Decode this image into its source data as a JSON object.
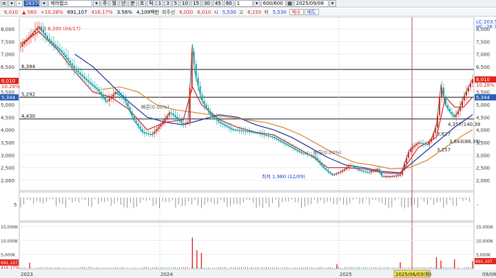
{
  "toolbar": {
    "stock_code": "263700",
    "stock_name": "케어랩스",
    "periods": [
      "주",
      "월",
      "년",
      "분",
      "초",
      "틱"
    ],
    "minute_intervals": [
      "1",
      "3",
      "5",
      "10",
      "15",
      "30",
      "45",
      "60"
    ],
    "count_display": "600/600",
    "date": "2025/09/08"
  },
  "quote": {
    "price": "6,010",
    "change": "560",
    "change_pct": "+10.28%",
    "volume": "691,107",
    "volume_ratio": "416.17%",
    "turnover": "3.56%",
    "amount": "4,109백만",
    "turnover_label": "회주선",
    "prev_close": "6,020",
    "open_label": "시",
    "open": "5,530",
    "high_label": "고",
    "high": "6,150",
    "low_label": "저",
    "low": "5,530",
    "buy_label": "매수",
    "sell_label": "매도",
    "fake_price": "6,010"
  },
  "right_labels": {
    "lc": "LC:203.5",
    "hc": "HC:-26.7",
    "price_tag": "6,010",
    "pct_tag": "10.28%",
    "tag_5344": "5,344",
    "volume_tag": "691,107",
    "volume_pct": "416.17%"
  },
  "colors": {
    "up": "#e0241a",
    "down": "#1a3fd8",
    "candle_down": "#17a5a8",
    "ma_red": "#d21f1f",
    "ma_navy": "#1c2c9c",
    "ma_orange": "#d9822b",
    "highlight_bg": "#fde84a",
    "selected_bg": "#2c5fb8"
  },
  "chart_data": {
    "type": "line",
    "title": "",
    "x_ticks": [
      "2023",
      "2024",
      "2025",
      "09/08"
    ],
    "selected_date": "2025/06/03(화)",
    "y_ticks": [
      "8,000",
      "7,500",
      "7,000",
      "6,500",
      "6,000",
      "5,500",
      "5,000",
      "4,500",
      "4,000",
      "3,500",
      "3,000",
      "2,500",
      "2,000"
    ],
    "ylim": [
      1700,
      8300
    ],
    "horizontal_levels": [
      {
        "value": 6394,
        "label": "6,394"
      },
      {
        "value": 5292,
        "label": "5,292"
      },
      {
        "value": 4430,
        "label": "4,430"
      }
    ],
    "annotations": {
      "high": "최고 8,200 (04/17)",
      "low": "최저 1,980 (12/09)",
      "pattern1": "빠른(0.00%)",
      "pattern2": "빠른(0.00%)",
      "level_a": "4,357(140.39",
      "level_b": "3,827",
      "level_c": "3,843(86.39)",
      "level_d": "3,257"
    },
    "price_series": {
      "name": "",
      "t": [
        0,
        0.02,
        0.04,
        0.06,
        0.09,
        0.12,
        0.15,
        0.17,
        0.19,
        0.21,
        0.23,
        0.25,
        0.27,
        0.29,
        0.31,
        0.33,
        0.35,
        0.36,
        0.37,
        0.38,
        0.385,
        0.4,
        0.42,
        0.44,
        0.47,
        0.5,
        0.53,
        0.56,
        0.59,
        0.62,
        0.65,
        0.67,
        0.69,
        0.71,
        0.73,
        0.75,
        0.77,
        0.79,
        0.8,
        0.82,
        0.84,
        0.86,
        0.88,
        0.9,
        0.91,
        0.92,
        0.93,
        0.94,
        0.95,
        0.96,
        0.97,
        0.98,
        1.0
      ],
      "values": [
        7300,
        7700,
        8100,
        7600,
        7100,
        6400,
        5900,
        5600,
        5100,
        5500,
        5200,
        4400,
        3900,
        3800,
        4200,
        4700,
        4400,
        4200,
        4300,
        7400,
        6300,
        5200,
        4600,
        4300,
        4000,
        3950,
        3850,
        3700,
        3400,
        3100,
        2950,
        2500,
        2200,
        2350,
        2600,
        2400,
        2300,
        2450,
        2150,
        2150,
        2200,
        3200,
        3500,
        3400,
        3700,
        4200,
        5800,
        5000,
        4700,
        4500,
        4800,
        5300,
        6010
      ]
    },
    "ma_red": {
      "name": "",
      "t": [
        0,
        0.04,
        0.08,
        0.12,
        0.16,
        0.2,
        0.24,
        0.28,
        0.32,
        0.36,
        0.38,
        0.4,
        0.44,
        0.48,
        0.52,
        0.56,
        0.6,
        0.64,
        0.68,
        0.72,
        0.76,
        0.8,
        0.84,
        0.88,
        0.92,
        0.94,
        0.96,
        0.98,
        1.0
      ],
      "values": [
        7400,
        7900,
        7200,
        6300,
        5500,
        5300,
        4800,
        4000,
        4300,
        4400,
        5700,
        5000,
        4400,
        4100,
        3900,
        3800,
        3400,
        3000,
        2500,
        2500,
        2450,
        2300,
        2250,
        3300,
        3700,
        5300,
        4900,
        4900,
        5300
      ]
    },
    "ma_navy": {
      "name": "",
      "t": [
        0.12,
        0.16,
        0.2,
        0.24,
        0.28,
        0.32,
        0.36,
        0.4,
        0.44,
        0.48,
        0.52,
        0.56,
        0.6,
        0.64,
        0.68,
        0.72,
        0.76,
        0.8,
        0.84,
        0.88,
        0.92,
        0.96,
        1.0
      ],
      "values": [
        7000,
        6500,
        5800,
        5100,
        4500,
        4300,
        4200,
        4400,
        4600,
        4500,
        4200,
        4000,
        3700,
        3300,
        2900,
        2600,
        2500,
        2350,
        2300,
        2900,
        3500,
        4100,
        4600
      ]
    },
    "ma_orange": {
      "name": "",
      "t": [
        0.18,
        0.22,
        0.26,
        0.3,
        0.34,
        0.38,
        0.42,
        0.46,
        0.5,
        0.54,
        0.58,
        0.62,
        0.66,
        0.7,
        0.74,
        0.78,
        0.82,
        0.86,
        0.9,
        0.94,
        0.98,
        1.0
      ],
      "values": [
        5600,
        5700,
        5500,
        5000,
        4800,
        4700,
        4600,
        4500,
        4400,
        4300,
        4100,
        3800,
        3400,
        3000,
        2700,
        2600,
        2450,
        2500,
        2800,
        3300,
        3800,
        4000
      ]
    },
    "indicator_ticks": [
      "5",
      "-"
    ],
    "volume_ticks": [
      "15,000K",
      "10,000K",
      "5,000K"
    ],
    "volume_spikes": [
      {
        "t": 0.02,
        "value": 2000
      },
      {
        "t": 0.38,
        "value": 11000
      },
      {
        "t": 0.39,
        "value": 6500
      },
      {
        "t": 0.4,
        "value": 5500
      },
      {
        "t": 0.7,
        "value": 1500
      },
      {
        "t": 0.84,
        "value": 2200
      },
      {
        "t": 0.92,
        "value": 4000
      },
      {
        "t": 0.93,
        "value": 2800
      },
      {
        "t": 0.96,
        "value": 3200
      },
      {
        "t": 1.0,
        "value": 2600
      }
    ]
  }
}
